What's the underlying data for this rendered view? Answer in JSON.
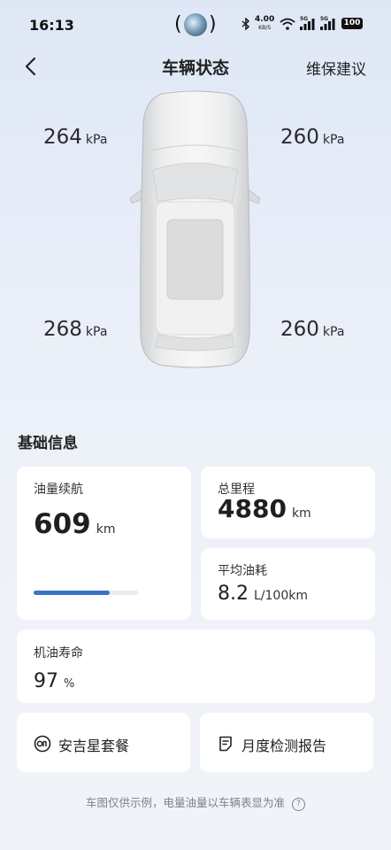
{
  "status_bar": {
    "time": "16:13",
    "net_speed_value": "4.00",
    "net_speed_unit": "KB/S",
    "signal1_label": "5G",
    "signal2_label": "5G",
    "battery": "100"
  },
  "header": {
    "title": "车辆状态",
    "right_action": "维保建议"
  },
  "tires": {
    "front_left": {
      "value": "264",
      "unit": "kPa"
    },
    "front_right": {
      "value": "260",
      "unit": "kPa"
    },
    "rear_left": {
      "value": "268",
      "unit": "kPa"
    },
    "rear_right": {
      "value": "260",
      "unit": "kPa"
    }
  },
  "basic_info": {
    "title": "基础信息",
    "fuel_range": {
      "label": "油量续航",
      "value": "609",
      "unit": "km",
      "fuel_level_fraction": 0.73
    },
    "odometer": {
      "label": "总里程",
      "value": "4880",
      "unit": "km"
    },
    "avg_consumption": {
      "label": "平均油耗",
      "value": "8.2",
      "unit": "L/100km"
    },
    "oil_life": {
      "label": "机油寿命",
      "value": "97",
      "unit": "%"
    }
  },
  "actions": {
    "anjixing": {
      "label": "安吉星套餐",
      "icon": "onstar-icon"
    },
    "monthly_report": {
      "label": "月度检测报告",
      "icon": "report-icon"
    }
  },
  "footnote": "车图仅供示例，电量油量以车辆表显为准"
}
